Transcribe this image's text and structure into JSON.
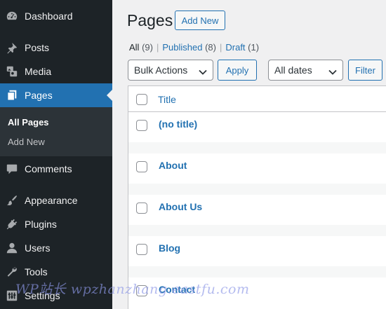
{
  "sidebar": {
    "items": [
      {
        "label": "Dashboard",
        "icon": "dashboard-icon"
      },
      {
        "label": "Posts",
        "icon": "pin-icon"
      },
      {
        "label": "Media",
        "icon": "media-icon"
      },
      {
        "label": "Pages",
        "icon": "pages-icon"
      },
      {
        "label": "Comments",
        "icon": "comment-icon"
      },
      {
        "label": "Appearance",
        "icon": "brush-icon"
      },
      {
        "label": "Plugins",
        "icon": "plug-icon"
      },
      {
        "label": "Users",
        "icon": "user-icon"
      },
      {
        "label": "Tools",
        "icon": "wrench-icon"
      },
      {
        "label": "Settings",
        "icon": "settings-icon"
      }
    ],
    "submenu": {
      "all_pages": "All Pages",
      "add_new": "Add New"
    }
  },
  "header": {
    "title": "Pages",
    "add_new": "Add New"
  },
  "filters": {
    "all_label": "All",
    "all_count": "(9)",
    "published_label": "Published",
    "published_count": "(8)",
    "draft_label": "Draft",
    "draft_count": "(1)",
    "separator": "|"
  },
  "actions": {
    "bulk_select": "Bulk Actions",
    "apply": "Apply",
    "dates_select": "All dates",
    "filter": "Filter"
  },
  "table": {
    "title_header": "Title",
    "rows": [
      "(no title)",
      "About",
      "About Us",
      "Blog",
      "Contact"
    ]
  },
  "watermark": "WP站长 wpzhanzhang.eastfu.com",
  "colors": {
    "sidebar_bg": "#1d2327",
    "accent": "#2271b1",
    "submenu_bg": "#2c3338"
  }
}
